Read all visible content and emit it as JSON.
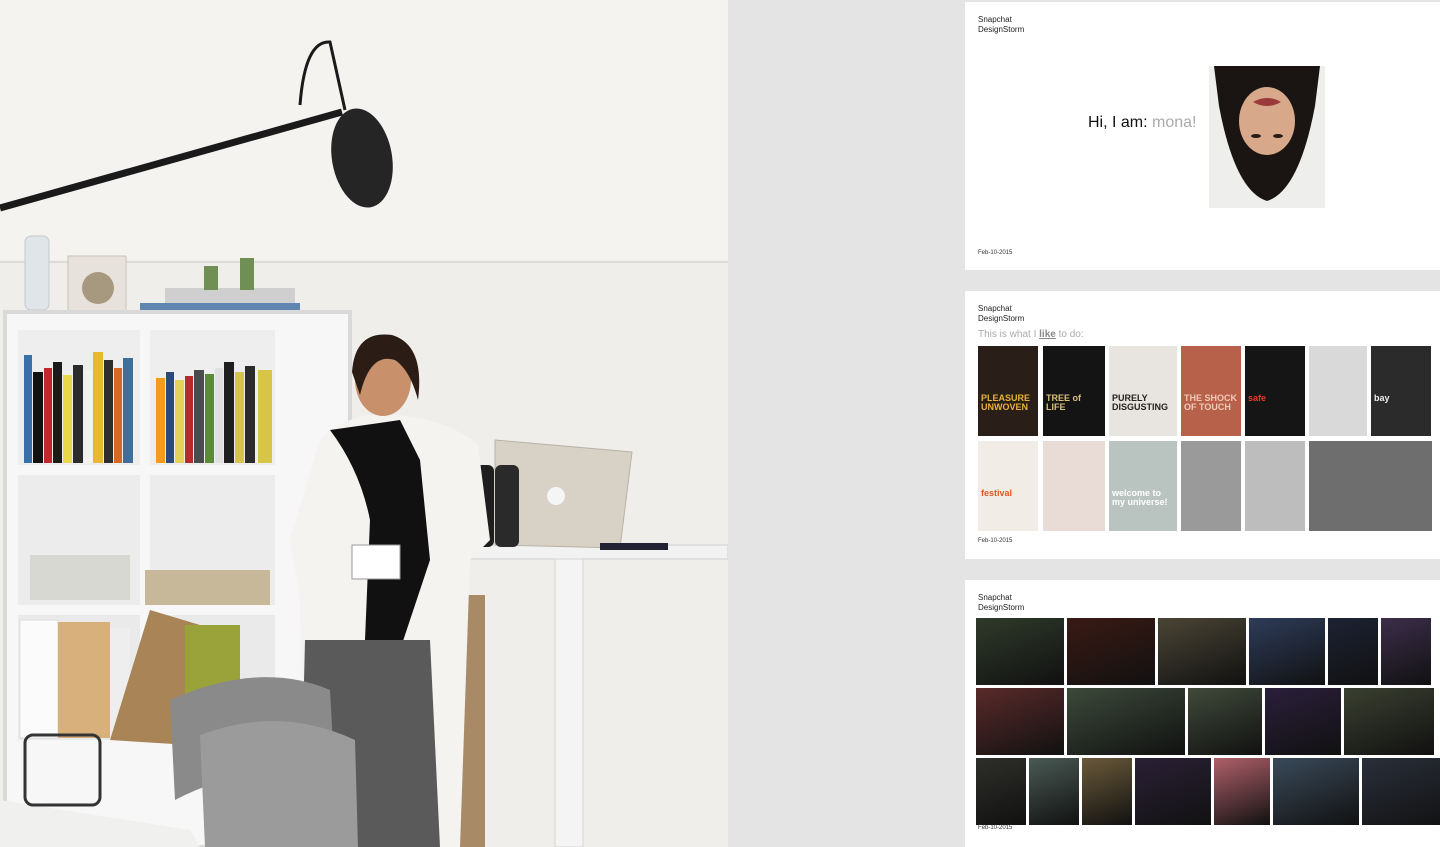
{
  "photo": {
    "description_icon": "presenter-photo"
  },
  "slides": [
    {
      "brand": "Snapchat",
      "subtitle": "DesignStorm",
      "greeting": "Hi, I am:",
      "name": "mona!",
      "date": "Feb-10-2015"
    },
    {
      "brand": "Snapchat",
      "subtitle": "DesignStorm",
      "intro_before": "This is what I",
      "intro_highlight": "like",
      "intro_after": "to do:",
      "date": "Feb-10-2015",
      "posters": [
        {
          "text": "PLEASURE UNWOVEN",
          "bg": "#2a1f18",
          "fg": "#e7b23a"
        },
        {
          "text": "TREE of LIFE",
          "bg": "#141414",
          "fg": "#d9c07a"
        },
        {
          "text": "PURELY DISGUSTING",
          "bg": "#e8e4df",
          "fg": "#222"
        },
        {
          "text": "THE SHOCK OF TOUCH",
          "bg": "#b8614a",
          "fg": "#f1c9b8"
        },
        {
          "text": "safe",
          "bg": "#151515",
          "fg": "#e63b2e"
        },
        {
          "text": "",
          "bg": "#d9d9d9",
          "fg": "#111"
        },
        {
          "text": "bay",
          "bg": "#2b2b2b",
          "fg": "#eee"
        },
        {
          "text": "festival",
          "bg": "#f1ede6",
          "fg": "#e2552a"
        },
        {
          "text": "",
          "bg": "#e9dcd6",
          "fg": "#c23b52"
        },
        {
          "text": "welcome to my universe!",
          "bg": "#b9c4c0",
          "fg": "#fff"
        },
        {
          "text": "",
          "bg": "#9a9a9a",
          "fg": "#fff"
        },
        {
          "text": "",
          "bg": "#bdbdbd",
          "fg": "#fff"
        },
        {
          "text": "",
          "bg": "#6e6e6e",
          "fg": "#fff"
        }
      ]
    },
    {
      "brand": "Snapchat",
      "subtitle": "DesignStorm",
      "date": "Feb-10-2015",
      "photos": [
        "#2f3a2a",
        "#3a1a14",
        "#4a4535",
        "#2e3c5a",
        "#1d2233",
        "#3c2e4a",
        "#5a2a2a",
        "#3c4a3a",
        "#404a3a",
        "#2a1f3a",
        "#3a4030",
        "#2e2e2a",
        "#4a5a55",
        "#6a5a3a",
        "#2a2035",
        "#b0606a",
        "#3a4a5a",
        "#2a2f3a",
        "#3a3530"
      ]
    }
  ]
}
